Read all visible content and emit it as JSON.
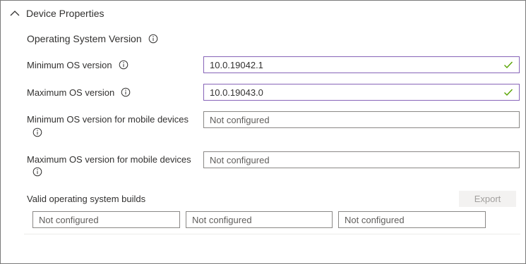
{
  "section": {
    "title": "Device Properties",
    "group_title": "Operating System Version"
  },
  "fields": {
    "min_os": {
      "label": "Minimum OS version",
      "value": "10.0.19042.1"
    },
    "max_os": {
      "label": "Maximum OS version",
      "value": "10.0.19043.0"
    },
    "min_os_mobile": {
      "label": "Minimum OS version for mobile devices",
      "placeholder": "Not configured"
    },
    "max_os_mobile": {
      "label": "Maximum OS version for mobile devices",
      "placeholder": "Not configured"
    }
  },
  "builds": {
    "label": "Valid operating system builds",
    "export_label": "Export",
    "inputs": [
      {
        "placeholder": "Not configured"
      },
      {
        "placeholder": "Not configured"
      },
      {
        "placeholder": "Not configured"
      }
    ]
  },
  "colors": {
    "valid_check": "#57a300",
    "focused_border": "#8764b8",
    "field_border": "#8a8886"
  },
  "icons": [
    "chevron-up-icon",
    "info-icon",
    "checkmark-icon"
  ]
}
